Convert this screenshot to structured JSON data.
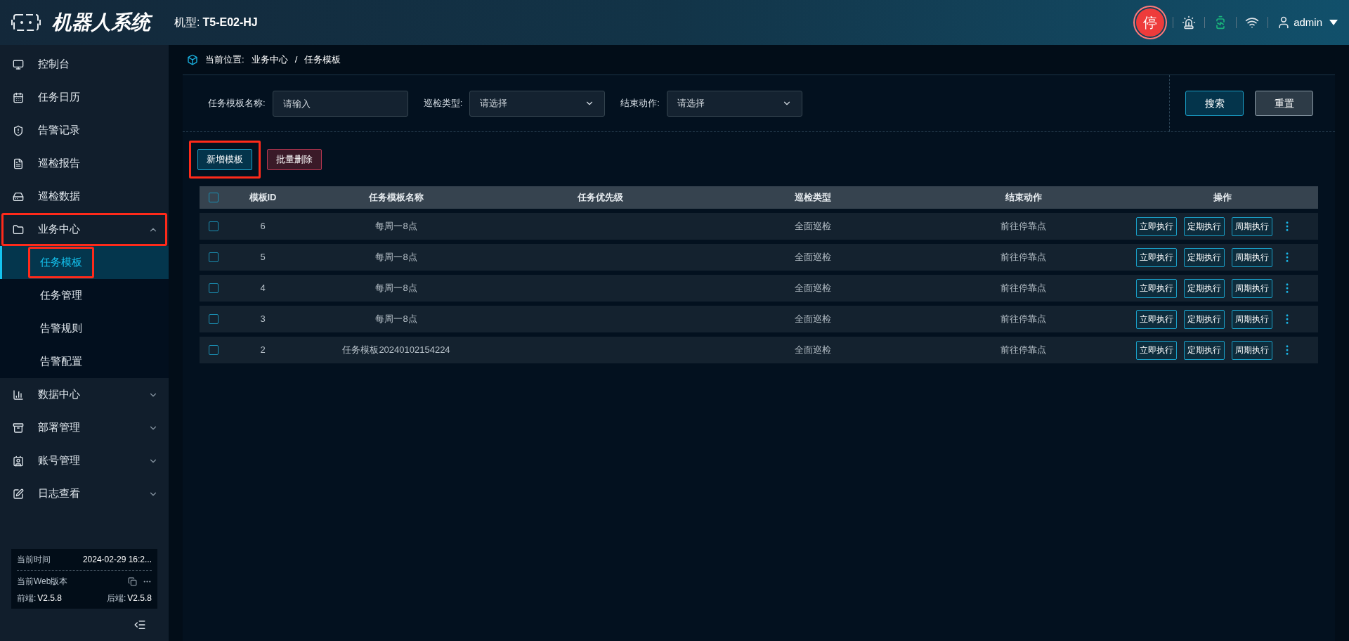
{
  "header": {
    "title": "机器人系统",
    "model_label": "机型:",
    "model_value": "T5-E02-HJ",
    "stop_button": "停",
    "user": "admin"
  },
  "sidebar": {
    "items": [
      {
        "kind": "link",
        "label": "控制台",
        "selected": false
      },
      {
        "kind": "link",
        "label": "任务日历",
        "selected": false
      },
      {
        "kind": "link",
        "label": "告警记录",
        "selected": false
      },
      {
        "kind": "link",
        "label": "巡检报告",
        "selected": false
      },
      {
        "kind": "link",
        "label": "巡检数据",
        "selected": false
      },
      {
        "kind": "group",
        "label": "业务中心",
        "expanded": true,
        "highlighted": true,
        "children": [
          {
            "label": "任务模板",
            "selected": true,
            "highlighted": true
          },
          {
            "label": "任务管理",
            "selected": false,
            "highlighted": false
          },
          {
            "label": "告警规则",
            "selected": false,
            "highlighted": false
          },
          {
            "label": "告警配置",
            "selected": false,
            "highlighted": false
          }
        ]
      },
      {
        "kind": "group",
        "label": "数据中心",
        "expanded": false,
        "highlighted": false
      },
      {
        "kind": "group",
        "label": "部署管理",
        "expanded": false,
        "highlighted": false
      },
      {
        "kind": "group",
        "label": "账号管理",
        "expanded": false,
        "highlighted": false
      },
      {
        "kind": "group",
        "label": "日志查看",
        "expanded": false,
        "highlighted": false
      }
    ],
    "info": {
      "time_label": "当前时间",
      "time_value": "2024-02-29 16:2...",
      "version_label": "当前Web版本",
      "frontend_label": "前端:",
      "frontend_value": "V2.5.8",
      "backend_label": "后端:",
      "backend_value": "V2.5.8"
    }
  },
  "breadcrumb": {
    "label": "当前位置:",
    "path": [
      "业务中心",
      "任务模板"
    ],
    "separator": "/"
  },
  "filters": [
    {
      "kind": "input",
      "label": "任务模板名称:",
      "placeholder": "请输入"
    },
    {
      "kind": "select",
      "label": "巡检类型:",
      "placeholder": "请选择"
    },
    {
      "kind": "select",
      "label": "结束动作:",
      "placeholder": "请选择"
    }
  ],
  "filter_buttons": [
    {
      "kind": "primary",
      "label": "搜索"
    },
    {
      "kind": "secondary",
      "label": "重置"
    }
  ],
  "actions": [
    {
      "kind": "primary",
      "label": "新增模板",
      "highlighted": true
    },
    {
      "kind": "danger",
      "label": "批量删除",
      "highlighted": false
    }
  ],
  "table": {
    "select_all": {
      "checked": false
    },
    "columns": [
      "模板ID",
      "任务模板名称",
      "任务优先级",
      "巡检类型",
      "结束动作",
      "操作"
    ],
    "rows": [
      {
        "checked": false,
        "id": "6",
        "name": "每周一8点",
        "patrol_type": "全面巡检",
        "end_action": "前往停靠点",
        "actions": [
          "立即执行",
          "定期执行",
          "周期执行"
        ]
      },
      {
        "checked": false,
        "id": "5",
        "name": "每周一8点",
        "patrol_type": "全面巡检",
        "end_action": "前往停靠点",
        "actions": [
          "立即执行",
          "定期执行",
          "周期执行"
        ]
      },
      {
        "checked": false,
        "id": "4",
        "name": "每周一8点",
        "patrol_type": "全面巡检",
        "end_action": "前往停靠点",
        "actions": [
          "立即执行",
          "定期执行",
          "周期执行"
        ]
      },
      {
        "checked": false,
        "id": "3",
        "name": "每周一8点",
        "patrol_type": "全面巡检",
        "end_action": "前往停靠点",
        "actions": [
          "立即执行",
          "定期执行",
          "周期执行"
        ]
      },
      {
        "checked": false,
        "id": "2",
        "name": "任务模板20240102154224",
        "patrol_type": "全面巡检",
        "end_action": "前往停靠点",
        "actions": [
          "立即执行",
          "定期执行",
          "周期执行"
        ]
      }
    ]
  }
}
